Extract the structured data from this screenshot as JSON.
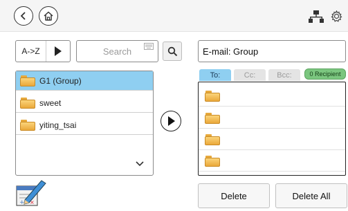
{
  "toolbar": {
    "back_icon": "back-circle-icon",
    "home_icon": "home-icon",
    "network_icon": "network-icon",
    "settings_icon": "gear-icon"
  },
  "sort": {
    "label": "A->Z"
  },
  "search": {
    "placeholder": "Search"
  },
  "subject": {
    "value": "E-mail: Group"
  },
  "groups": [
    {
      "label": "G1 (Group)",
      "selected": true
    },
    {
      "label": "sweet",
      "selected": false
    },
    {
      "label": "yiting_tsai",
      "selected": false
    }
  ],
  "tabs": {
    "to": "To:",
    "cc": "Cc:",
    "bcc": "Bcc:"
  },
  "recipient_badge": "0 Recipient",
  "buttons": {
    "delete": "Delete",
    "delete_all": "Delete All"
  },
  "colors": {
    "selected": "#8fcff1",
    "badge": "#7bc67f"
  }
}
